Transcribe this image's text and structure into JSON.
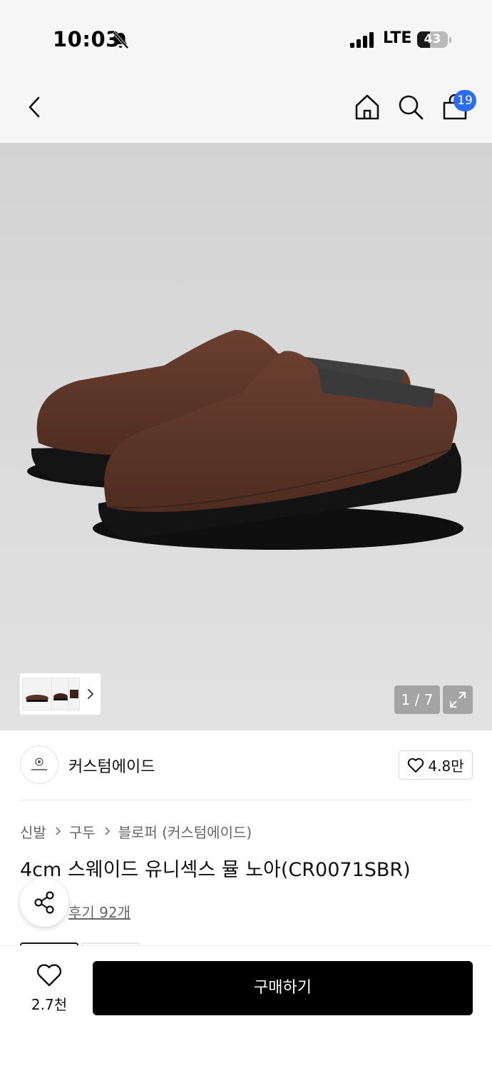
{
  "status_bar": {
    "time": "10:03",
    "network": "LTE",
    "battery": "43",
    "battery_level": 0.43
  },
  "header": {
    "back_icon": "chevron-left-icon",
    "home_icon": "home-icon",
    "search_icon": "search-icon",
    "cart_icon": "shopping-bag-icon",
    "cart_badge": "19",
    "badge_color": "#2a6cf0"
  },
  "gallery": {
    "page_indicator": "1 / 7",
    "expand_icon": "expand-icon",
    "thumbnail_more_icon": "chevron-right-icon"
  },
  "brand": {
    "name": "커스텀에이드",
    "likes": "4.8만"
  },
  "breadcrumb": {
    "items": [
      "신발",
      "구두",
      "블로퍼 (커스텀에이드)"
    ]
  },
  "product": {
    "title": "4cm 스웨이드 유니섹스 뮬 노아(CR0071SBR)",
    "review_link": "후기 92개",
    "share_icon": "share-icon"
  },
  "bottom_bar": {
    "wish_count": "2.7천",
    "buy_label": "구매하기"
  }
}
